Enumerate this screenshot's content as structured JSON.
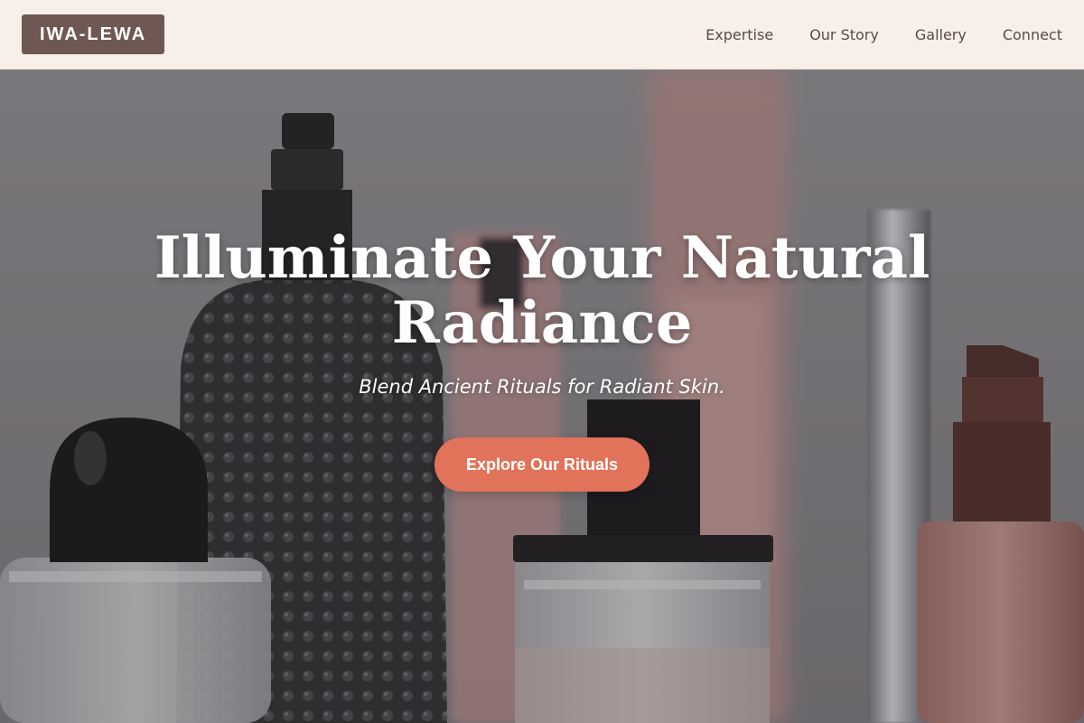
{
  "header": {
    "logo_text": "IWA-LEWA",
    "nav": [
      {
        "label": "Expertise"
      },
      {
        "label": "Our Story"
      },
      {
        "label": "Gallery"
      },
      {
        "label": "Connect"
      }
    ]
  },
  "hero": {
    "title": "Illuminate Your Natural Radiance",
    "subtitle": "Blend Ancient Rituals for Radiant Skin.",
    "cta_label": "Explore Our Rituals",
    "background_image": "blurred photo of perfume and cosmetic bottles"
  },
  "colors": {
    "header_bg": "#f7efe8",
    "logo_bg": "#6f5852",
    "nav_text": "#5b4a45",
    "cta_bg": "#e07359",
    "hero_text": "#ffffff"
  }
}
